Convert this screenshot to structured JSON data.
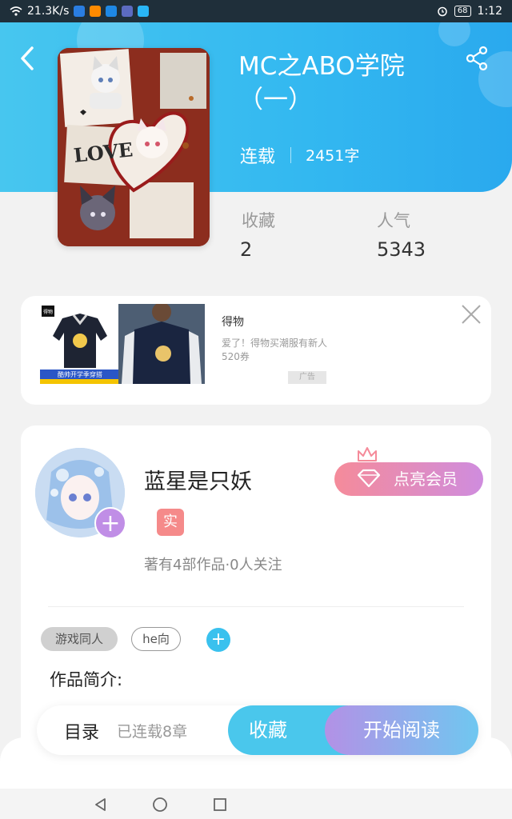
{
  "status_bar": {
    "speed": "21.3K/s",
    "battery": "68",
    "time": "1:12",
    "app_icon_colors": [
      "#2a7de1",
      "#ff8a00",
      "#1e88e5",
      "#5c6bc0",
      "#29b6f6"
    ]
  },
  "header": {
    "back_icon": "chevron-left-icon",
    "share_icon": "share-icon"
  },
  "book": {
    "title_line1": "MC之ABO学院",
    "title_line2": "（一）",
    "status": "连载",
    "word_count": "2451字",
    "cover_text": "LOVE",
    "stats": {
      "favorites_label": "收藏",
      "favorites_value": "2",
      "popularity_label": "人气",
      "popularity_value": "5343"
    }
  },
  "ad": {
    "brand_logo": "得物",
    "image_caption": "酷帅开学季穿搭",
    "title": "得物",
    "description": "爱了！得物买潮服有新人520券",
    "tag": "广告"
  },
  "author": {
    "name": "蓝星是只妖",
    "real_badge": "实",
    "meta": "著有4部作品·0人关注",
    "vip_button": "点亮会员"
  },
  "tags": {
    "items": [
      "游戏同人",
      "he向"
    ]
  },
  "intro": {
    "label": "作品简介:"
  },
  "bottom_bar": {
    "toc_label": "目录",
    "chapters": "已连载8章",
    "collect_button": "收藏",
    "read_button": "开始阅读"
  },
  "colors": {
    "header_blue": "#33b8f0",
    "accent_cyan": "#4ac7ec",
    "vip_pink": "#f58b9a",
    "vip_purple": "#cf8cde",
    "badge_red": "#f58a8a"
  }
}
